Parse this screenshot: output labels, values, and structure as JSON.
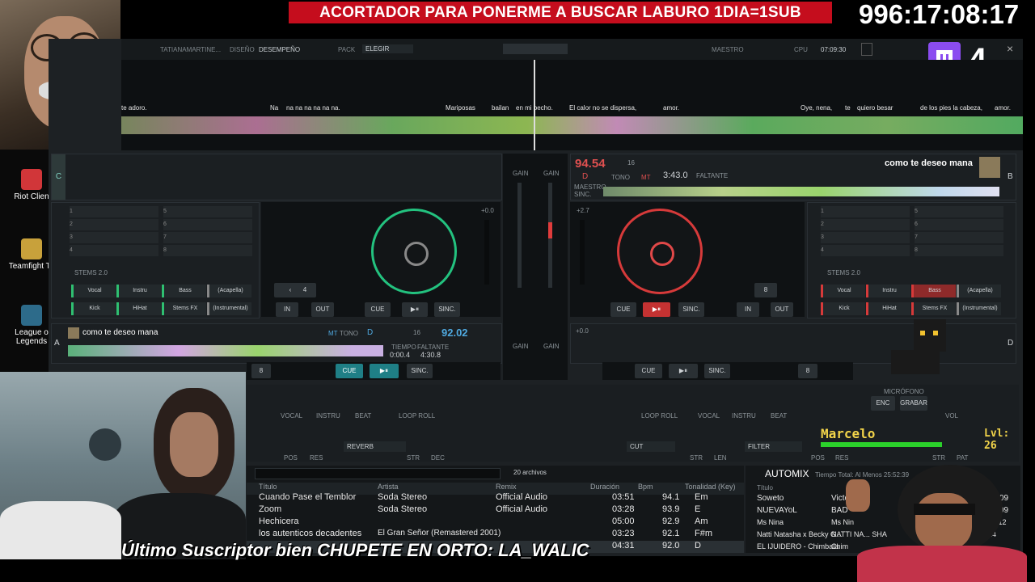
{
  "overlay": {
    "banner": "ACORTADOR PARA PONERME A BUSCAR LABURO 1DIA=1SUB",
    "clock": "996:17:08:17",
    "twitch_count": "4",
    "subscriber": "Último Suscriptor bien CHUPETE EN ORTO: LA_WALIC",
    "marcelo_name": "Marcelo",
    "marcelo_level": "Lvl: 26"
  },
  "desktop": {
    "icons": [
      {
        "label": "Riot Clien"
      },
      {
        "label": "Teamfight Ta"
      },
      {
        "label": "League o Legends"
      }
    ]
  },
  "topbar": {
    "user": "TATIANAMARTINE...",
    "layout_label": "DISEÑO",
    "layout_value": "DESEMPEÑO",
    "pack_label": "PACK",
    "pack_value": "ELEGIR",
    "master_label": "MAESTRO",
    "cpu_label": "CPU",
    "time": "07:09:30"
  },
  "lyrics": [
    "te adoro.",
    "Na",
    "na na na na na na.",
    "Mariposas",
    "bailan",
    "en mi pecho.",
    "El calor no se dispersa,",
    "amor.",
    "Oye, nena,",
    "te",
    "quiero besar",
    "de los pies la cabeza,",
    "amor."
  ],
  "deckC": {
    "letter": "C"
  },
  "deckB": {
    "letter": "B",
    "bpm": "94.54",
    "beat": "16",
    "key": "D",
    "tono": "TONO",
    "mt": "MT",
    "master": "MAESTRO",
    "sync": "SINC.",
    "remaining": "3:43.0",
    "remaining_label": "FALTANTE",
    "title": "como te deseo mana",
    "pitch": "+2.7",
    "loop": "8",
    "cue": "CUE",
    "sinc": "SINC.",
    "in": "IN",
    "out": "OUT",
    "stems": "STEMS 2.0",
    "pads": [
      "Vocal",
      "Instru",
      "Bass",
      "(Acapella)",
      "Kick",
      "HiHat",
      "Stems FX",
      "(Instrumental)"
    ]
  },
  "deckA": {
    "letter": "A",
    "title": "como te deseo mana",
    "bpm": "92.02",
    "beat": "16",
    "key": "D",
    "mt": "MT",
    "tono": "TONO",
    "elapsed_label": "TIEMPO",
    "elapsed": "0:00.4",
    "remaining_label": "FALTANTE",
    "remaining": "4:30.8",
    "pitch": "+0.0",
    "loop": "4",
    "loop2": "8",
    "cue": "CUE",
    "sinc": "SINC.",
    "in": "IN",
    "out": "OUT",
    "stems": "STEMS 2.0",
    "pads": [
      "Vocal",
      "Instru",
      "Bass",
      "(Acapella)",
      "Kick",
      "HiHat",
      "Stems FX",
      "(Instrumental)"
    ]
  },
  "deckD": {
    "letter": "D",
    "pitch": "+0.0",
    "loop": "8",
    "cue": "CUE",
    "sinc": "SINC."
  },
  "mixer": {
    "gain": "GAIN",
    "left_knobs": [
      "VOCAL",
      "INSTRU",
      "BEAT",
      "LOOP ROLL"
    ],
    "right_knobs": [
      "LOOP ROLL",
      "VOCAL",
      "INSTRU",
      "BEAT"
    ],
    "fx_left": "REVERB",
    "fx_right": "CUT",
    "fx_right2": "FILTER",
    "pos": "POS",
    "res": "RES",
    "str": "STR",
    "dec": "DEC",
    "len": "LEN",
    "pat": "PAT",
    "mic_label": "MICRÓFONO",
    "enc": "ENC",
    "grabar": "GRABAR",
    "vol": "VOL",
    "maestro": "MAESTRO"
  },
  "browser": {
    "count": "20 archivos",
    "columns": [
      "Título",
      "Artista",
      "Remix",
      "Duración",
      "Bpm",
      "Tonalidad (Key)"
    ],
    "rows": [
      {
        "title": "Cuando Pase el Temblor",
        "artist": "Soda Stereo",
        "remix": "Official Audio",
        "duration": "03:51",
        "bpm": "94.1",
        "key": "Em"
      },
      {
        "title": "Zoom",
        "artist": "Soda Stereo",
        "remix": "Official Audio",
        "duration": "03:28",
        "bpm": "93.9",
        "key": "E"
      },
      {
        "title": "Hechicera",
        "artist": "",
        "remix": "",
        "duration": "05:00",
        "bpm": "92.9",
        "key": "Am"
      },
      {
        "title": "los autenticos decadentes",
        "artist": "El Gran Señor (Remastered 2001)",
        "remix": "",
        "duration": "03:23",
        "bpm": "92.1",
        "key": "F#m"
      },
      {
        "title": "",
        "artist": "",
        "remix": "",
        "duration": "04:31",
        "bpm": "92.0",
        "key": "D"
      }
    ]
  },
  "automix": {
    "title": "AUTOMIX",
    "total": "Tiempo Total: Al Menos 25:52:39",
    "col_title": "Título",
    "rows": [
      {
        "title": "Soweto",
        "artist": "Victor",
        "time": "07:09"
      },
      {
        "title": "NUEVAYoL",
        "artist": "BAD",
        "time": "07:09"
      },
      {
        "title": "Ms Nina",
        "artist": "Ms Nin",
        "time": "07:12"
      },
      {
        "title": "Natti Natasha x Becky G...",
        "artist": "NATTI NA... SHA",
        "time": "14"
      },
      {
        "title": "EL IJUIDERO - Chimbala",
        "artist": "Chim",
        "time": ""
      }
    ]
  }
}
